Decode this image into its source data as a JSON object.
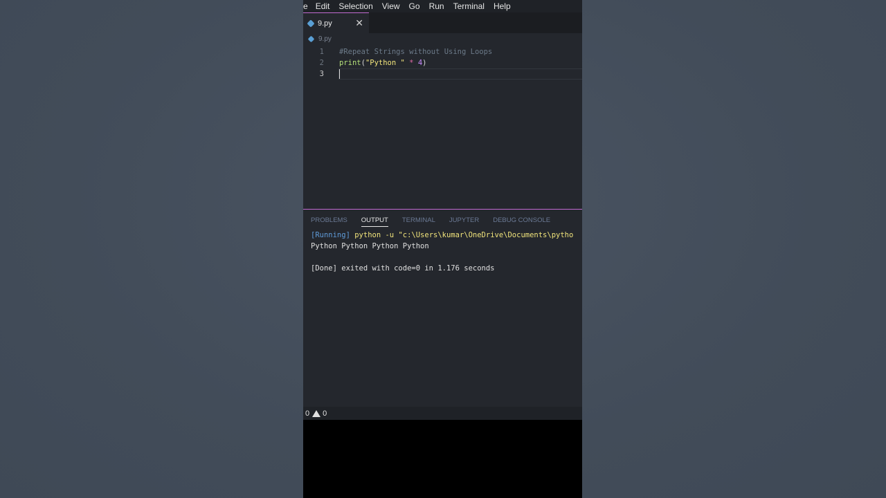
{
  "menu": [
    "e",
    "Edit",
    "Selection",
    "View",
    "Go",
    "Run",
    "Terminal",
    "Help"
  ],
  "tab": {
    "filename": "9.py",
    "close": "✕"
  },
  "breadcrumb": "9.py",
  "editor": {
    "lines": [
      {
        "num": "1",
        "comment": "#Repeat Strings without Using Loops"
      },
      {
        "num": "2",
        "fn": "print",
        "open": "(",
        "str": "\"Python \"",
        "op": " * ",
        "num_val": "4",
        "close": ")"
      },
      {
        "num": "3"
      }
    ]
  },
  "panel": {
    "tabs": [
      "PROBLEMS",
      "OUTPUT",
      "TERMINAL",
      "JUPYTER",
      "DEBUG CONSOLE"
    ],
    "active_tab": "OUTPUT",
    "running_label": "[Running]",
    "command": " python -u \"c:\\Users\\kumar\\OneDrive\\Documents\\pytho",
    "output": "Python Python Python Python",
    "done": "[Done] exited with code=0 in 1.176 seconds"
  },
  "status": {
    "errors": "0",
    "warnings": "0"
  }
}
